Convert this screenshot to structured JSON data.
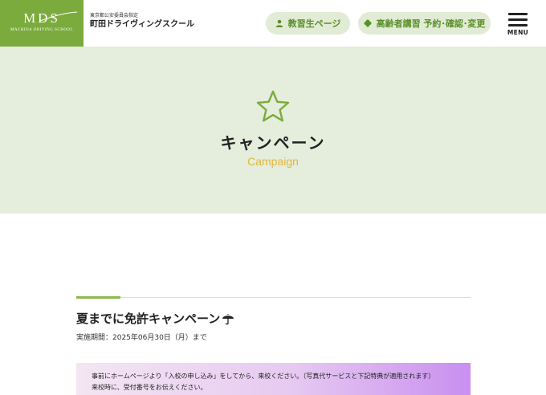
{
  "header": {
    "logo": {
      "mark": "MDS",
      "sub": "MACHIDA DRIVING SCHOOL"
    },
    "school_tag": "東京都公安委員会指定",
    "school_name": "町田ドライヴィングスクール",
    "student_page_label": "教習生ページ",
    "senior_course_label": "高齢者講習 予約･確認･変更",
    "menu_label": "MENU"
  },
  "hero": {
    "icon": "star-icon",
    "title": "キャンペーン",
    "subtitle": "Campaign"
  },
  "post": {
    "title": "夏までに免許キャンペーン",
    "title_icon": "umbrella-icon",
    "period": "実施期間：2025年06月30日（月）まで",
    "notice_line1": "事前にホームページより「入校の申し込み」をしてから、来校ください。（写真代サービスと下記特典が適用されます）",
    "notice_line2": "来校時に、受付番号をお伝えください。"
  },
  "colors": {
    "brand_green": "#7aab3c",
    "pill_bg": "#e2ebd5",
    "pill_text": "#5a8f2a",
    "hero_bg": "#e5eddc",
    "accent_yellow": "#e3b63a",
    "notice_purple": "#c98ff0"
  }
}
